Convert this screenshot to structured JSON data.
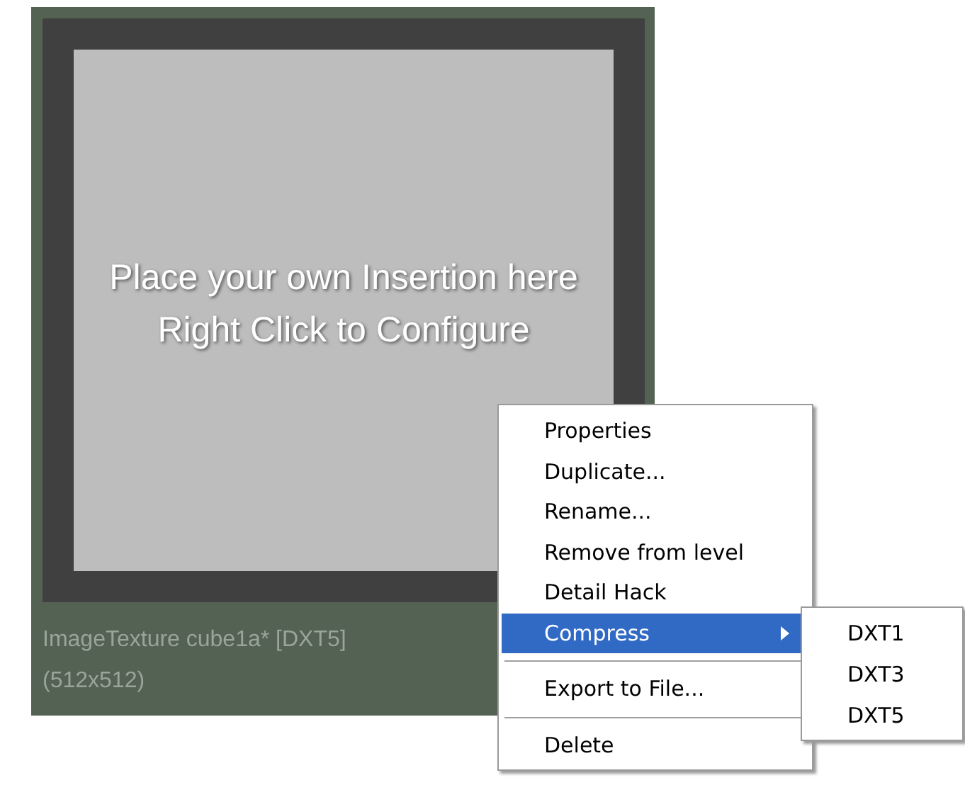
{
  "thumbnail": {
    "overlay_lines": [
      "Place your own Insertion here",
      "Right Click to Configure"
    ],
    "caption_lines": [
      "ImageTexture cube1a* [DXT5]",
      "(512x512)"
    ]
  },
  "context_menu": {
    "items": [
      {
        "kind": "item",
        "label": "Properties",
        "selected": false,
        "submenu": false
      },
      {
        "kind": "item",
        "label": "Duplicate...",
        "selected": false,
        "submenu": false
      },
      {
        "kind": "item",
        "label": "Rename...",
        "selected": false,
        "submenu": false
      },
      {
        "kind": "item",
        "label": "Remove from level",
        "selected": false,
        "submenu": false
      },
      {
        "kind": "item",
        "label": "Detail Hack",
        "selected": false,
        "submenu": false
      },
      {
        "kind": "item",
        "label": "Compress",
        "selected": true,
        "submenu": true
      },
      {
        "kind": "separator"
      },
      {
        "kind": "item",
        "label": "Export to File...",
        "selected": false,
        "submenu": false
      },
      {
        "kind": "separator"
      },
      {
        "kind": "item",
        "label": "Delete",
        "selected": false,
        "submenu": false
      }
    ]
  },
  "submenu": {
    "items": [
      {
        "label": "DXT1",
        "selected": false
      },
      {
        "label": "DXT3",
        "selected": false
      },
      {
        "label": "DXT5",
        "selected": false
      }
    ]
  }
}
